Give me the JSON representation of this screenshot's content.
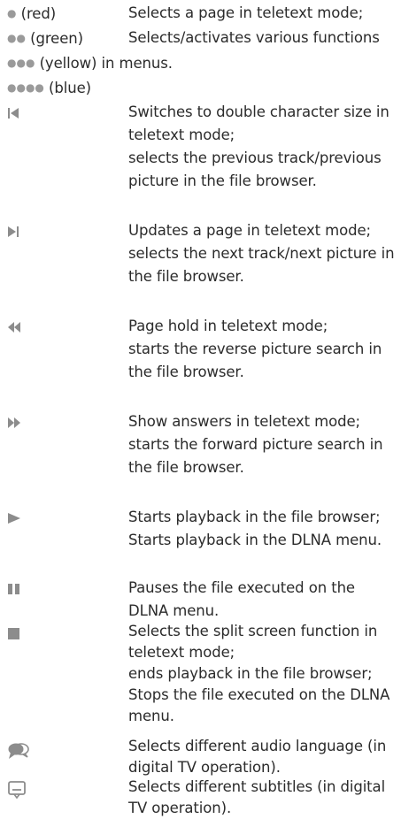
{
  "color_keys": {
    "red_label": "(red)",
    "green_label": "(green)",
    "yellow_label": "(yellow)",
    "blue_label": "(blue)",
    "desc_line1": "Selects a page in teletext mode;",
    "desc_line2": "Selects/activates various functions",
    "desc_line3": "in menus."
  },
  "buttons": [
    {
      "icon": "skip-back-icon",
      "lines": [
        "Switches to double character size in",
        "teletext mode;",
        "selects the previous track/previous",
        "picture in the file browser."
      ]
    },
    {
      "icon": "skip-forward-icon",
      "lines": [
        "Updates a page in teletext mode;",
        "selects the next track/next picture in",
        "the file browser."
      ]
    },
    {
      "icon": "rewind-icon",
      "lines": [
        "Page hold in teletext mode;",
        "starts the reverse picture search in",
        "the file browser."
      ]
    },
    {
      "icon": "fast-forward-icon",
      "lines": [
        "Show answers in teletext mode;",
        "starts the forward picture search in",
        "the file browser."
      ]
    },
    {
      "icon": "play-icon",
      "lines": [
        "Starts playback in the file browser;",
        "Starts playback in the DLNA menu."
      ]
    },
    {
      "icon": "pause-icon",
      "lines": [
        "Pauses the file executed on the",
        "DLNA menu."
      ]
    },
    {
      "icon": "stop-icon",
      "lines": [
        "Selects the split screen function in",
        "teletext mode;",
        "ends playback in the file browser;",
        "Stops the file executed on the DLNA",
        "menu."
      ]
    },
    {
      "icon": "audio-language-icon",
      "lines": [
        "Selects different audio language (in",
        "digital TV operation)."
      ]
    },
    {
      "icon": "subtitles-icon",
      "lines": [
        "Selects different subtitles (in digital",
        "TV operation)."
      ]
    }
  ]
}
